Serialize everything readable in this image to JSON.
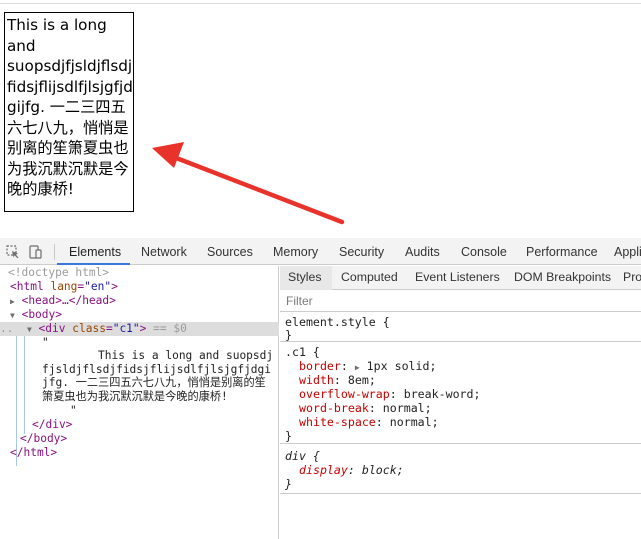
{
  "page": {
    "box_text": "This is a long and suopsdjfjsldjflsdjfidsjflijsdlfjlsjgfjdgijfg. 一二三四五六七八九，悄悄是别离的笙箫夏虫也为我沉默沉默是今晚的康桥!"
  },
  "devtools": {
    "tabs": [
      "Elements",
      "Network",
      "Sources",
      "Memory",
      "Security",
      "Audits",
      "Console",
      "Performance",
      "Appli"
    ],
    "active_tab": "Elements",
    "accent_color": "#3879d9",
    "elements": {
      "doctype": "<!doctype html>",
      "html_tag": "html",
      "lang_attr": "lang",
      "lang_value": "\"en\"",
      "head_collapsed": "<head>…</head>",
      "body_tag": "<body>",
      "div_tag": "div",
      "class_attr": "class",
      "class_value": "\"c1\"",
      "selected_marker": "== $0",
      "quote_open": "\"",
      "text_node": "This is a long and suopsdjfjsldjflsdjfidsjflijsdlfjlsjgfjdgijfg. 一二三四五六七八九，悄悄是别离的笙箫夏虫也为我沉默沉默是今晚的康桥!",
      "quote_close": "\"",
      "div_close": "</div>",
      "body_close": "</body>",
      "html_close": "</html>"
    },
    "styles": {
      "tabs": [
        "Styles",
        "Computed",
        "Event Listeners",
        "DOM Breakpoints",
        "Pro"
      ],
      "active_tab": "Styles",
      "filter_placeholder": "Filter",
      "element_style": {
        "selector": "element.style {",
        "close": "}"
      },
      "c1_rule": {
        "selector": ".c1 {",
        "props": [
          {
            "name": "border",
            "value": "1px solid;"
          },
          {
            "name": "width",
            "value": "8em;"
          },
          {
            "name": "overflow-wrap",
            "value": "break-word;"
          },
          {
            "name": "word-break",
            "value": "normal;"
          },
          {
            "name": "white-space",
            "value": "normal;"
          }
        ],
        "close": "}"
      },
      "div_rule": {
        "selector": "div {",
        "props": [
          {
            "name": "display",
            "value": "block;"
          }
        ],
        "close": "}"
      }
    }
  },
  "annotation_color": "#e8322a"
}
